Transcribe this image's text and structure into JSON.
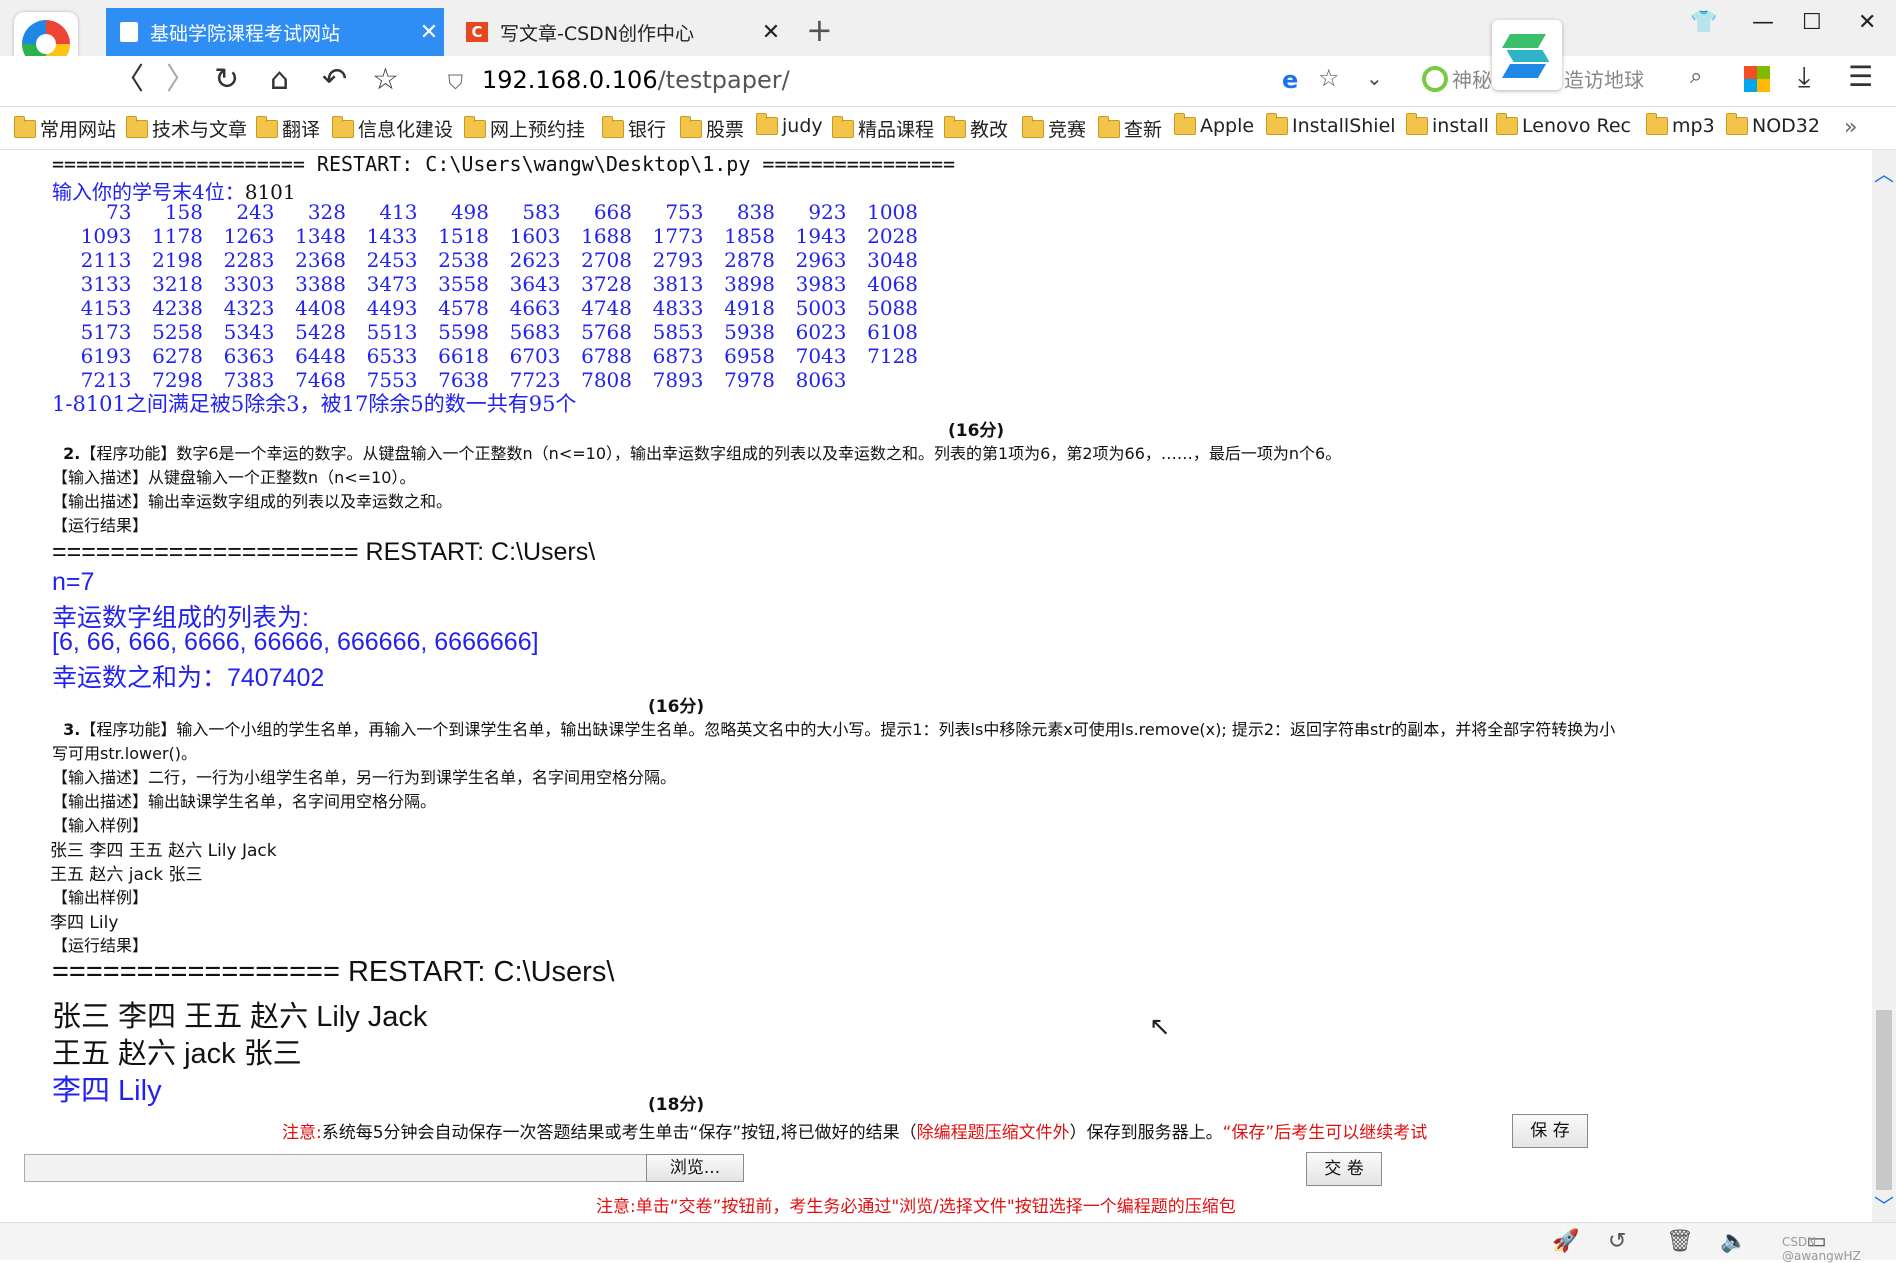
{
  "browser": {
    "tabs": [
      {
        "label": "基础学院课程考试网站",
        "active": true
      },
      {
        "label": "写文章-CSDN创作中心",
        "active": false,
        "icon_letter": "C"
      }
    ],
    "url_host": "192.168.0.106",
    "url_path": "/testpaper/",
    "search_placeholder_left": "神秘",
    "search_placeholder_right": "造访地球",
    "bookmarks": [
      "常用网站",
      "技术与文章",
      "翻译",
      "信息化建设",
      "网上预约挂",
      "银行",
      "股票",
      "judy",
      "精品课程",
      "教改",
      "竞赛",
      "查新",
      "Apple",
      "InstallShiel",
      "install",
      "Lenovo Rec",
      "mp3",
      "NOD32"
    ]
  },
  "q1_output": {
    "restart": "===================== RESTART: C:\\Users\\wangw\\Desktop\\1.py ================",
    "prompt": "输入你的学号末4位：",
    "prompt_value": "8101",
    "rows": [
      [
        "73",
        "158",
        "243",
        "328",
        "413",
        "498",
        "583",
        "668",
        "753",
        "838",
        "923",
        "1008"
      ],
      [
        "1093",
        "1178",
        "1263",
        "1348",
        "1433",
        "1518",
        "1603",
        "1688",
        "1773",
        "1858",
        "1943",
        "2028"
      ],
      [
        "2113",
        "2198",
        "2283",
        "2368",
        "2453",
        "2538",
        "2623",
        "2708",
        "2793",
        "2878",
        "2963",
        "3048"
      ],
      [
        "3133",
        "3218",
        "3303",
        "3388",
        "3473",
        "3558",
        "3643",
        "3728",
        "3813",
        "3898",
        "3983",
        "4068"
      ],
      [
        "4153",
        "4238",
        "4323",
        "4408",
        "4493",
        "4578",
        "4663",
        "4748",
        "4833",
        "4918",
        "5003",
        "5088"
      ],
      [
        "5173",
        "5258",
        "5343",
        "5428",
        "5513",
        "5598",
        "5683",
        "5768",
        "5853",
        "5938",
        "6023",
        "6108"
      ],
      [
        "6193",
        "6278",
        "6363",
        "6448",
        "6533",
        "6618",
        "6703",
        "6788",
        "6873",
        "6958",
        "7043",
        "7128"
      ],
      [
        "7213",
        "7298",
        "7383",
        "7468",
        "7553",
        "7638",
        "7723",
        "7808",
        "7893",
        "7978",
        "8063",
        ""
      ]
    ],
    "summary": "1-8101之间满足被5除余3，被17除余5的数一共有95个",
    "score": "(16分)"
  },
  "q2": {
    "title_num": "2.",
    "title": "【程序功能】数字6是一个幸运的数字。从键盘输入一个正整数n（n<=10），输出幸运数字组成的列表以及幸运数之和。列表的第1项为6，第2项为66，……，最后一项为n个6。",
    "input_desc": "【输入描述】从键盘输入一个正整数n（n<=10）。",
    "output_desc": "【输出描述】输出幸运数字组成的列表以及幸运数之和。",
    "run_result": "【运行结果】",
    "restart": "===================== RESTART: C:\\Users\\",
    "n_line": "n=7",
    "list_label": "幸运数字组成的列表为:",
    "list_value": "[6, 66, 666, 6666, 66666, 666666, 6666666]",
    "sum_line": "幸运数之和为：7407402",
    "score": "(16分)"
  },
  "q3": {
    "title_num": "3.",
    "title_line1": "【程序功能】输入一个小组的学生名单，再输入一个到课学生名单，输出缺课学生名单。忽略英文名中的大小写。提示1：列表ls中移除元素x可使用ls.remove(x); 提示2：返回字符串str的副本，并将全部字符转换为小",
    "title_line2": "写可用str.lower()。",
    "input_desc": "【输入描述】二行，一行为小组学生名单，另一行为到课学生名单，名字间用空格分隔。",
    "output_desc": "【输出描述】输出缺课学生名单，名字间用空格分隔。",
    "input_sample_label": "【输入样例】",
    "input_sample_1": "张三 李四 王五 赵六 Lily Jack",
    "input_sample_2": "王五 赵六 jack 张三",
    "output_sample_label": "【输出样例】",
    "output_sample": "李四 Lily",
    "run_result": "【运行结果】",
    "restart": "================= RESTART: C:\\Users\\",
    "run_in_1": "张三 李四 王五 赵六 Lily Jack",
    "run_in_2": "王五 赵六 jack 张三",
    "run_out": "李四 Lily",
    "score": "(18分)"
  },
  "footer": {
    "notice_prefix": "注意:",
    "notice_mid1": "系统每5分钟会自动保存一次答题结果或考生单击“保存”按钮,将已做好的结果（",
    "notice_red1": "除编程题压缩文件外",
    "notice_mid2": "）保存到服务器上。",
    "notice_red2": "“保存”后考生可以继续考试",
    "save_label": "保 存",
    "browse_label": "浏览...",
    "submit_label": "交 卷",
    "notice2": "注意:单击“交卷”按钮前，考生务必通过\"浏览/选择文件\"按钮选择一个编程题的压缩包"
  },
  "status": {
    "watermark": "CSDN @awangwHZ"
  },
  "colors": {
    "tab_active": "#2f8ef4",
    "output_blue": "#2222ee",
    "notice_red": "#e01010"
  }
}
